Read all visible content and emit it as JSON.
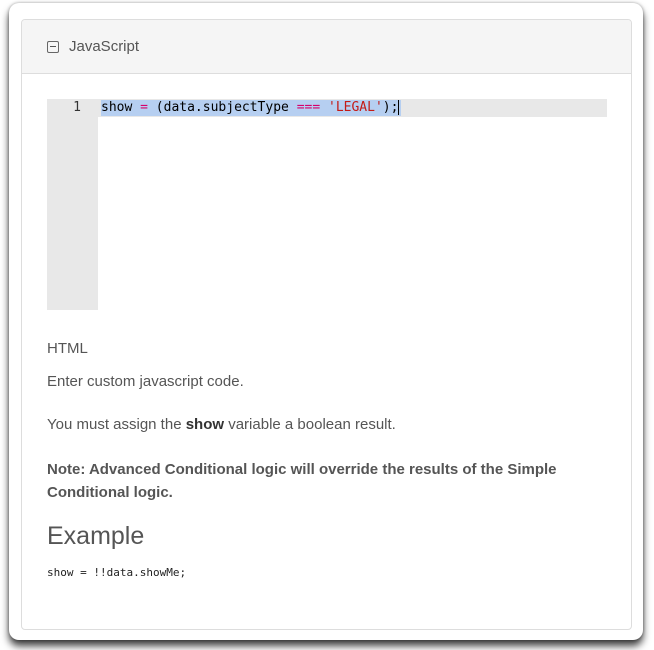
{
  "panel": {
    "title": "JavaScript",
    "collapse_icon": "minus-square-icon"
  },
  "editor": {
    "line_number": "1",
    "code": {
      "ident": "show",
      "op_assign": "=",
      "open": "(data.subjectType",
      "op_eq": "===",
      "string": "'LEGAL'",
      "close": ");"
    }
  },
  "help": {
    "title": "HTML",
    "p1": "Enter custom javascript code.",
    "p2_before": "You must assign the",
    "p2_bold": "show",
    "p2_after": "variable a boolean result.",
    "note": "Note: Advanced Conditional logic will override the results of the Simple Conditional logic.",
    "example_title": "Example",
    "example_code": "show = !!data.showMe;"
  },
  "colors": {
    "operator": "#d6006b",
    "string": "#c41a16",
    "selection": "#b6cff1",
    "gutter": "#e8e8e8"
  }
}
